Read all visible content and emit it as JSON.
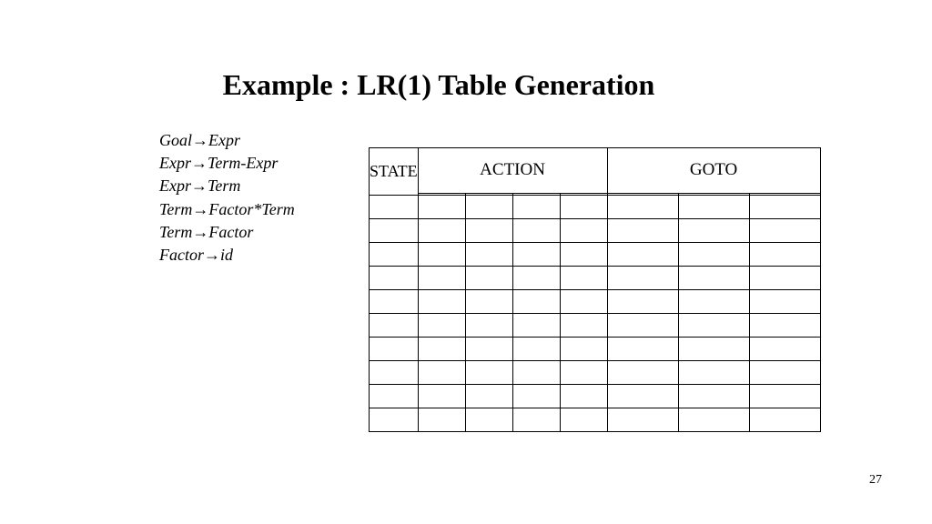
{
  "title": "Example : LR(1) Table Generation",
  "grammar": {
    "rules": [
      {
        "lhs": "Goal",
        "rhs": "Expr"
      },
      {
        "lhs": "Expr",
        "rhs": "Term-Expr"
      },
      {
        "lhs": "Expr",
        "rhs": "Term"
      },
      {
        "lhs": "Term",
        "rhs": "Factor*Term"
      },
      {
        "lhs": "Term",
        "rhs": "Factor"
      },
      {
        "lhs": "Factor",
        "rhs": "id"
      }
    ]
  },
  "table": {
    "headers": {
      "state": "STATE",
      "action": "ACTION",
      "goto": "GOTO"
    },
    "action_columns": 4,
    "goto_columns": 3,
    "body_rows": 10
  },
  "page_number": "27"
}
